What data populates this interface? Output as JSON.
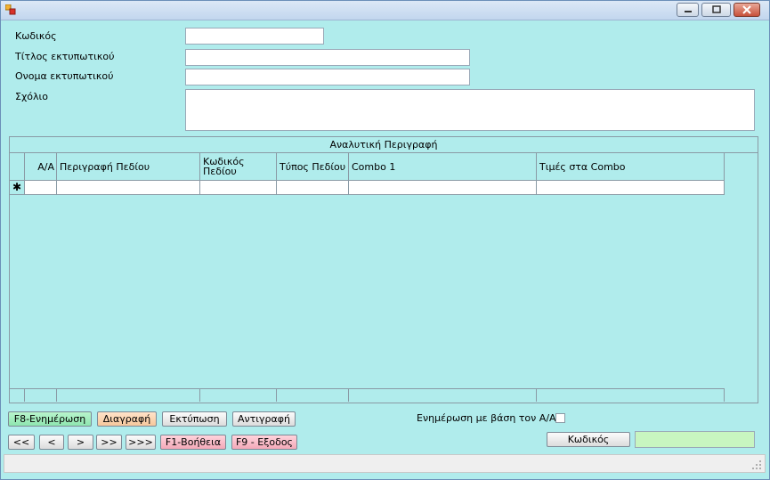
{
  "form": {
    "code_label": "Κωδικός",
    "printer_title_label": "Τίτλος εκτυπωτικού",
    "printer_name_label": "Ονομα εκτυπωτικού",
    "comment_label": "Σχόλιο",
    "code_value": "",
    "printer_title_value": "",
    "printer_name_value": "",
    "comment_value": ""
  },
  "grid": {
    "caption": "Αναλυτική Περιγραφή",
    "columns": [
      "Α/Α",
      "Περιγραφή Πεδίου",
      "Κωδικός Πεδίου",
      "Τύπος Πεδίου",
      "Combo 1",
      "Τιμές στα Combo"
    ],
    "new_row_marker": "✱"
  },
  "buttons": {
    "update": "F8-Ενημέρωση",
    "delete": "Διαγραφή",
    "print": "Εκτύπωση",
    "copy": "Αντιγραφή",
    "first": "<<",
    "prev": "<",
    "next": ">",
    "next_page": ">>",
    "last": ">>>",
    "help": "F1-Βοήθεια",
    "exit": "F9 - Εξοδος",
    "code_search": "Κωδικός"
  },
  "options": {
    "update_by_aa_label": "Ενημέρωση με βάση τον Α/Α",
    "update_by_aa_checked": false
  },
  "search": {
    "value": ""
  },
  "colors": {
    "background": "#b0ecec",
    "green_button": "#8ee6b0",
    "peach_button": "#f6c79c",
    "pink_button": "#f3a9b8"
  }
}
